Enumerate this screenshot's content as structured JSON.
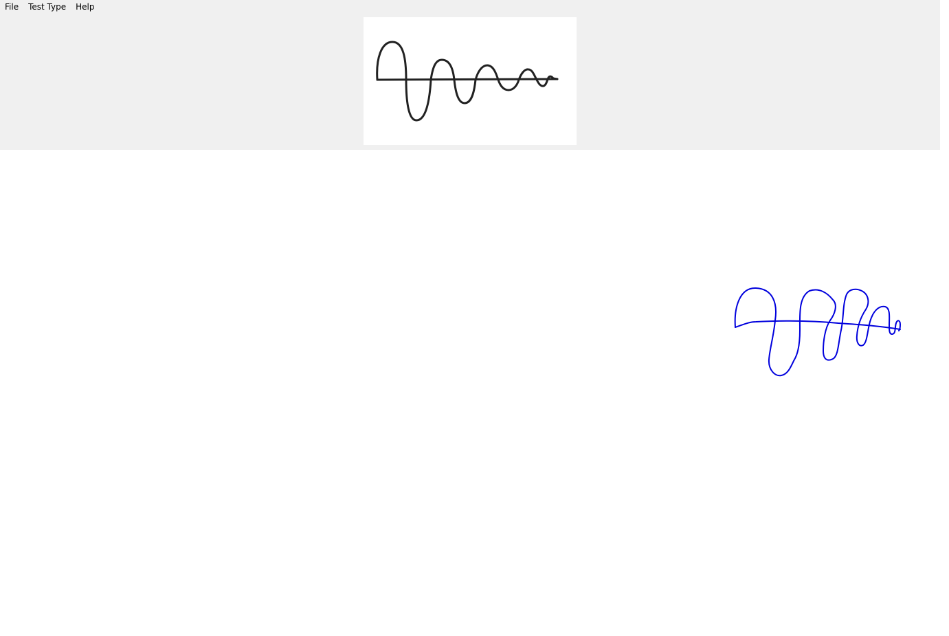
{
  "menu": {
    "items": [
      {
        "label": "File"
      },
      {
        "label": "Test Type"
      },
      {
        "label": "Help"
      }
    ]
  },
  "reference_image": {
    "kind": "decaying-sine-wave-template",
    "stroke_color": "#222222"
  },
  "user_drawing": {
    "kind": "freehand-trace",
    "stroke_color": "#0000dd"
  },
  "colors": {
    "panel_background": "#f0f0f0",
    "canvas_background": "#ffffff"
  }
}
